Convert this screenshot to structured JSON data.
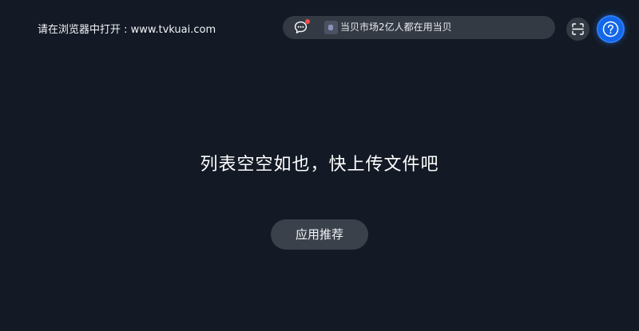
{
  "header": {
    "open_hint": "请在浏览器中打开 : www.tvkuai.com",
    "message_bar": {
      "chat_icon": "chat-bubble-icon",
      "has_notification": true,
      "notification_color": "#ff4a4a",
      "text": "当贝市场2亿人都在用当贝"
    },
    "scan_icon": "scan-icon",
    "help_icon": "help-icon"
  },
  "main": {
    "empty_message": "列表空空如也，快上传文件吧",
    "recommend_button": "应用推荐"
  },
  "colors": {
    "background": "#131a25",
    "pill": "#343a44",
    "help_accent": "#1366e8"
  }
}
